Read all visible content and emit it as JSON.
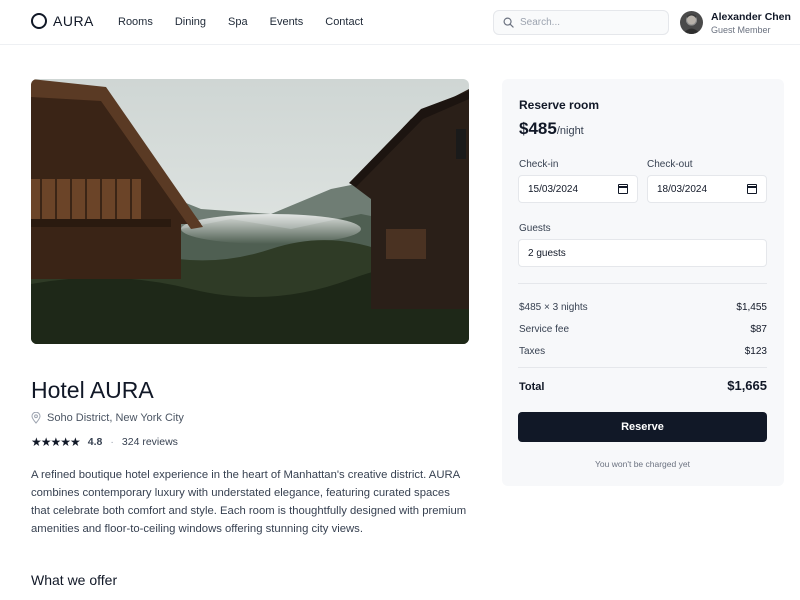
{
  "header": {
    "logo": "AURA",
    "nav": [
      "Rooms",
      "Dining",
      "Spa",
      "Events",
      "Contact"
    ],
    "search_placeholder": "Search...",
    "user": {
      "name": "Alexander Chen",
      "role": "Guest Member"
    }
  },
  "hotel": {
    "name": "Hotel AURA",
    "location": "Soho District, New York City",
    "rating": "4.8",
    "stars": 5,
    "reviews": "324 reviews",
    "description": "A refined boutique hotel experience in the heart of Manhattan's creative district. AURA combines contemporary luxury with understated elegance, featuring curated spaces that celebrate both comfort and style. Each room is thoughtfully designed with premium amenities and floor-to-ceiling windows offering stunning city views.",
    "offer_title": "What we offer"
  },
  "booking": {
    "title": "Reserve room",
    "price": "$485",
    "per_night": "/night",
    "checkin_label": "Check-in",
    "checkin_value": "15/03/2024",
    "checkout_label": "Check-out",
    "checkout_value": "18/03/2024",
    "guests_label": "Guests",
    "guests_value": "2 guests",
    "lines": [
      {
        "label": "$485 × 3 nights",
        "amount": "$1,455"
      },
      {
        "label": "Service fee",
        "amount": "$87"
      },
      {
        "label": "Taxes",
        "amount": "$123"
      }
    ],
    "total_label": "Total",
    "total_amount": "$1,665",
    "button": "Reserve",
    "note": "You won't be charged yet"
  },
  "colors": {
    "primary": "#111827",
    "card_bg": "#f7f8fa",
    "border": "#e5e7eb",
    "muted": "#6b7280"
  }
}
